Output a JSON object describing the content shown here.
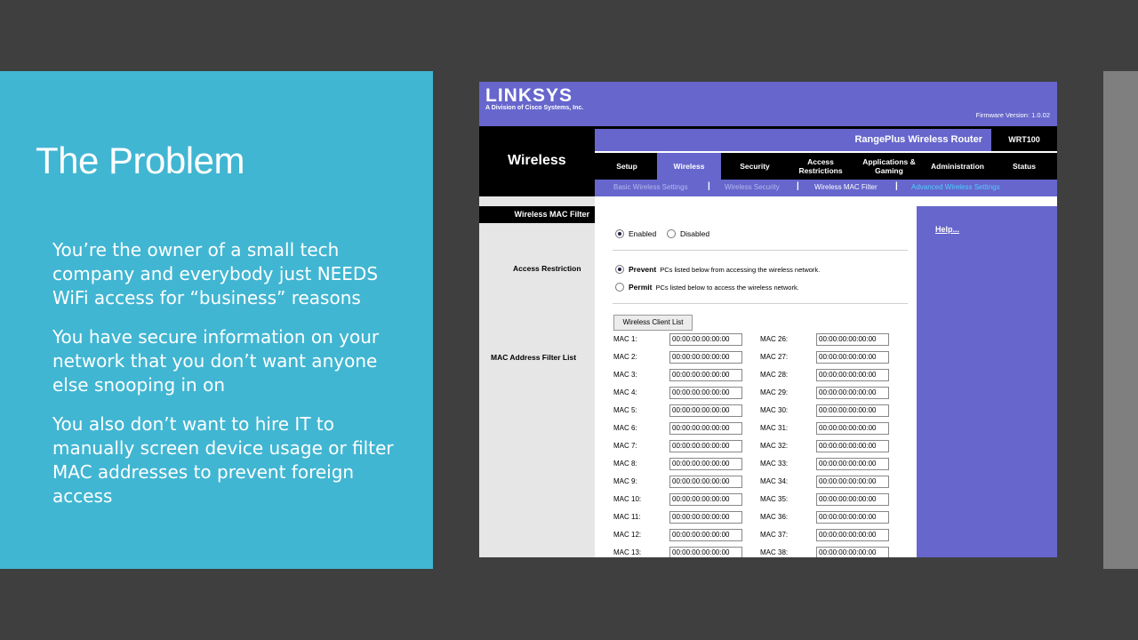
{
  "slide": {
    "title": "The Problem",
    "bullets": [
      "You’re the owner of a small tech company and everybody just NEEDS WiFi access for “business” reasons",
      "You have secure information on your network that you don’t want anyone else snooping in on",
      "You also don’t want to hire IT to manually screen device usage or filter MAC addresses  to prevent foreign access"
    ]
  },
  "router": {
    "logo": "LINKSYS",
    "logo_sub": "A Division of Cisco Systems, Inc.",
    "firmware": "Firmware Version: 1.0.02",
    "section": "Wireless",
    "product": "RangePlus Wireless Router",
    "model": "WRT100",
    "tabs": [
      "Setup",
      "Wireless",
      "Security",
      "Access Restrictions",
      "Applications & Gaming",
      "Administration",
      "Status"
    ],
    "active_tab": "Wireless",
    "subtabs": [
      "Basic Wireless Settings",
      "Wireless Security",
      "Wireless MAC Filter",
      "Advanced Wireless Settings"
    ],
    "active_subtab": "Wireless MAC Filter",
    "page_title": "Wireless MAC Filter",
    "help": "Help...",
    "enable": {
      "enabled": "Enabled",
      "disabled": "Disabled",
      "selected": "Enabled"
    },
    "access_restriction": {
      "label": "Access Restriction",
      "prevent_label": "Prevent",
      "prevent_desc": "PCs listed below from accessing the wireless network.",
      "permit_label": "Permit",
      "permit_desc": "PCs listed below to access the wireless network.",
      "selected": "Prevent"
    },
    "client_list_button": "Wireless Client List",
    "mac_filter_label": "MAC Address Filter List",
    "mac_left": [
      {
        "label": "MAC 1:",
        "value": "00:00:00:00:00:00"
      },
      {
        "label": "MAC 2:",
        "value": "00:00:00:00:00:00"
      },
      {
        "label": "MAC 3:",
        "value": "00:00:00:00:00:00"
      },
      {
        "label": "MAC 4:",
        "value": "00:00:00:00:00:00"
      },
      {
        "label": "MAC 5:",
        "value": "00:00:00:00:00:00"
      },
      {
        "label": "MAC 6:",
        "value": "00:00:00:00:00:00"
      },
      {
        "label": "MAC 7:",
        "value": "00:00:00:00:00:00"
      },
      {
        "label": "MAC 8:",
        "value": "00:00:00:00:00:00"
      },
      {
        "label": "MAC 9:",
        "value": "00:00:00:00:00:00"
      },
      {
        "label": "MAC 10:",
        "value": "00:00:00:00:00:00"
      },
      {
        "label": "MAC 11:",
        "value": "00:00:00:00:00:00"
      },
      {
        "label": "MAC 12:",
        "value": "00:00:00:00:00:00"
      },
      {
        "label": "MAC 13:",
        "value": "00:00:00:00:00:00"
      }
    ],
    "mac_right": [
      {
        "label": "MAC 26:",
        "value": "00:00:00:00:00:00"
      },
      {
        "label": "MAC 27:",
        "value": "00:00:00:00:00:00"
      },
      {
        "label": "MAC 28:",
        "value": "00:00:00:00:00:00"
      },
      {
        "label": "MAC 29:",
        "value": "00:00:00:00:00:00"
      },
      {
        "label": "MAC 30:",
        "value": "00:00:00:00:00:00"
      },
      {
        "label": "MAC 31:",
        "value": "00:00:00:00:00:00"
      },
      {
        "label": "MAC 32:",
        "value": "00:00:00:00:00:00"
      },
      {
        "label": "MAC 33:",
        "value": "00:00:00:00:00:00"
      },
      {
        "label": "MAC 34:",
        "value": "00:00:00:00:00:00"
      },
      {
        "label": "MAC 35:",
        "value": "00:00:00:00:00:00"
      },
      {
        "label": "MAC 36:",
        "value": "00:00:00:00:00:00"
      },
      {
        "label": "MAC 37:",
        "value": "00:00:00:00:00:00"
      },
      {
        "label": "MAC 38:",
        "value": "00:00:00:00:00:00"
      }
    ],
    "colors": {
      "purple": "#6666cc",
      "black": "#000000",
      "slide_cyan": "#41b6d2"
    }
  }
}
